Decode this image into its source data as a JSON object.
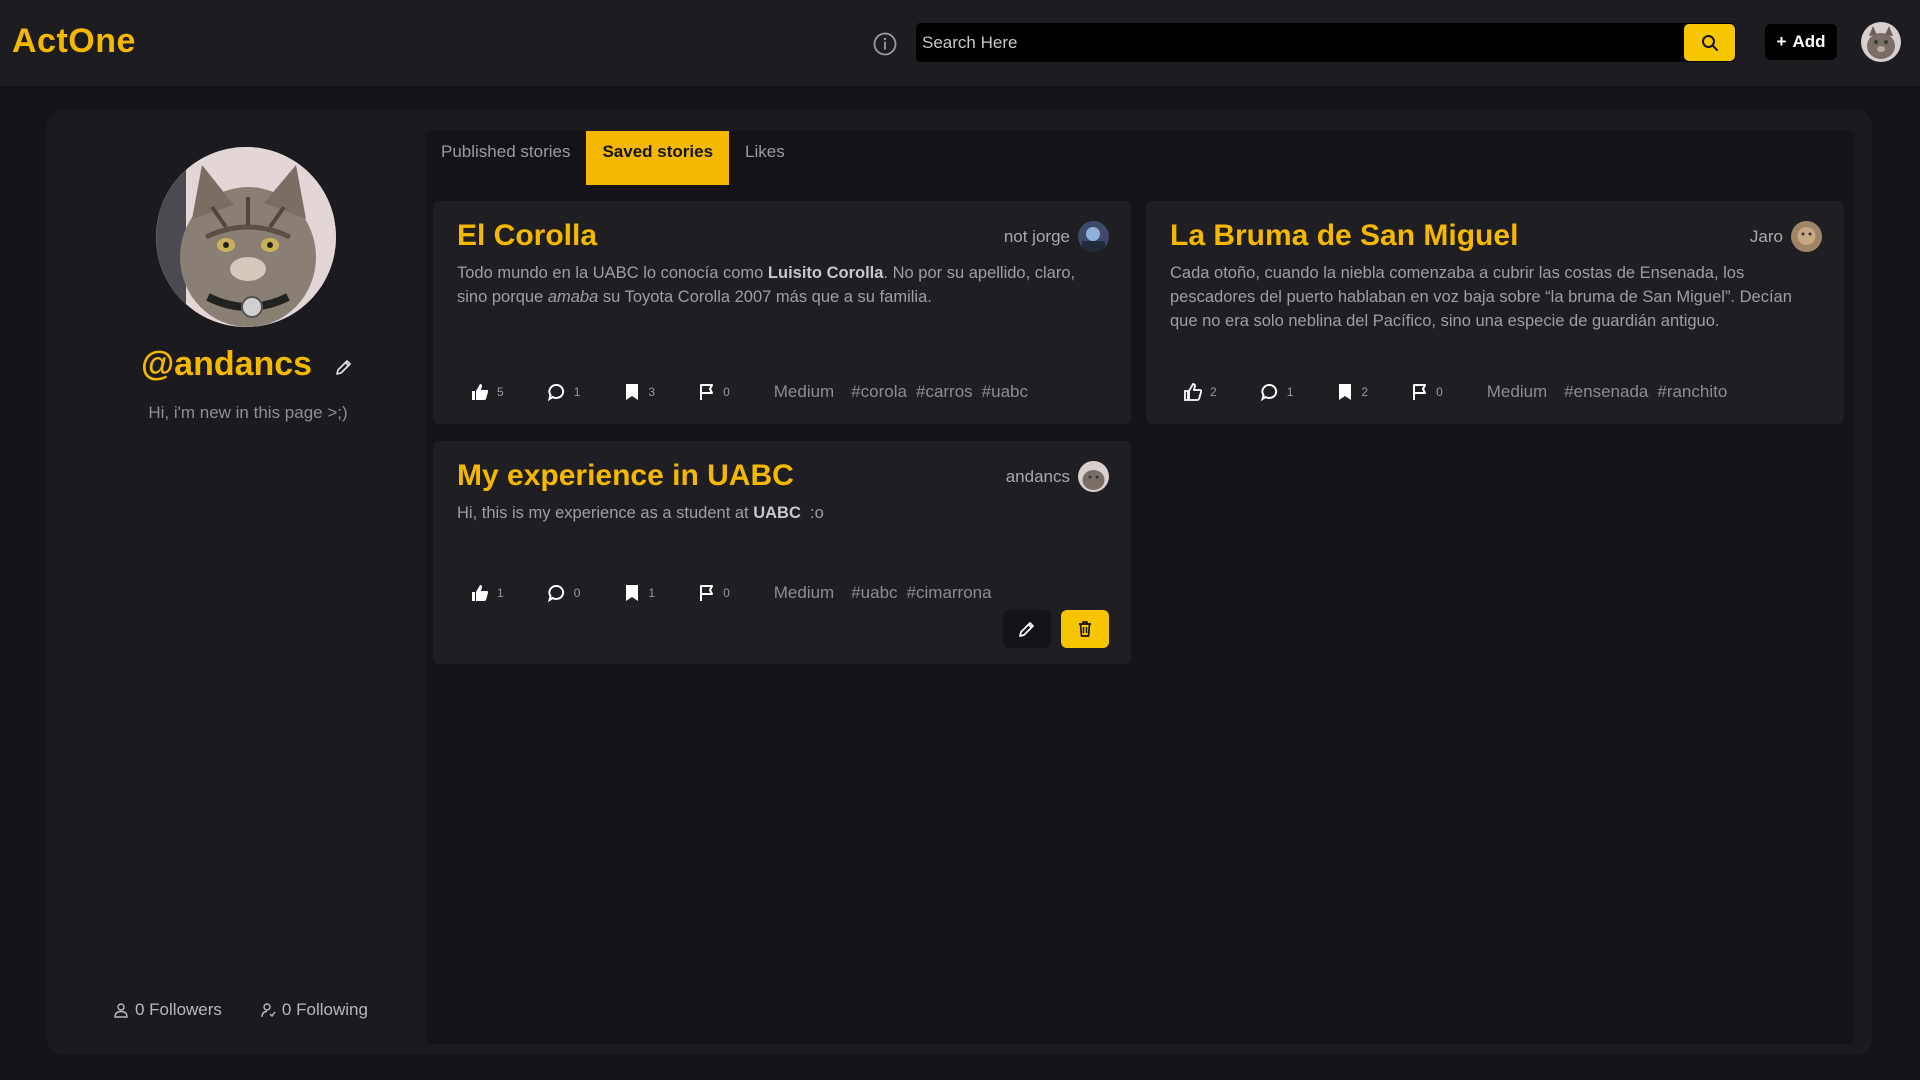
{
  "app": {
    "brand": "ActOne"
  },
  "header": {
    "search_placeholder": "Search Here",
    "add_label": "Add"
  },
  "profile": {
    "username": "@andancs",
    "bio": "Hi, i'm new in this page >;)",
    "followers": "0 Followers",
    "following": "0 Following"
  },
  "tabs": [
    {
      "label": "Published stories",
      "active": false
    },
    {
      "label": "Saved stories",
      "active": true
    },
    {
      "label": "Likes",
      "active": false
    }
  ],
  "stories": [
    {
      "title": "El Corolla",
      "author": "not jorge",
      "body_parts": [
        "Todo mundo en la UABC lo conocía como ",
        "Luisito Corolla",
        ". No por su apellido, claro, sino porque ",
        "amaba",
        " su Toyota Corolla 2007 más que a su familia."
      ],
      "likes": "5",
      "comments": "1",
      "saves": "3",
      "reports": "0",
      "level": "Medium",
      "tags": [
        "#corola",
        "#carros",
        "#uabc"
      ]
    },
    {
      "title": "La Bruma de San Miguel",
      "author": "Jaro",
      "body": "Cada otoño, cuando la niebla comenzaba a cubrir las costas de Ensenada, los pescadores del puerto hablaban en voz baja sobre “la bruma de San Miguel”. Decían que no era solo neblina del Pacífico, sino una especie de guardián antiguo.",
      "likes": "2",
      "comments": "1",
      "saves": "2",
      "reports": "0",
      "level": "Medium",
      "tags": [
        "#ensenada",
        "#ranchito"
      ]
    },
    {
      "title": "My experience in UABC",
      "author": "andancs",
      "body_parts": [
        "Hi, this is my experience as a student at ",
        "UABC",
        "  :o"
      ],
      "likes": "1",
      "comments": "0",
      "saves": "1",
      "reports": "0",
      "level": "Medium",
      "tags": [
        "#uabc",
        "#cimarrona"
      ]
    }
  ],
  "colors": {
    "accent": "#f5b800",
    "background": "#141418",
    "panel": "#1b1b1f",
    "card": "#1e1e23"
  }
}
